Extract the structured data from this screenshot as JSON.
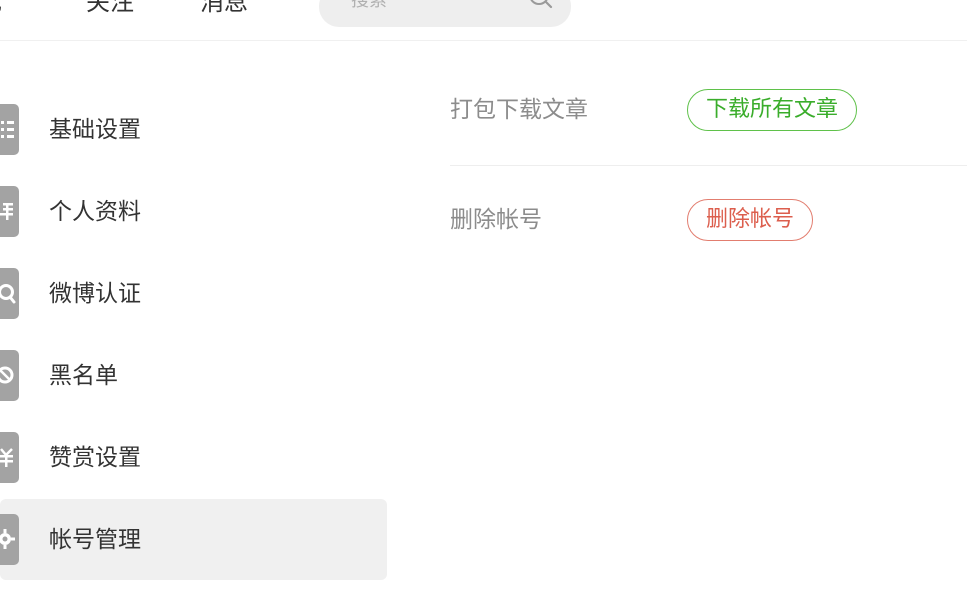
{
  "topnav": {
    "links": [
      "现",
      "关注",
      "消息"
    ],
    "search": {
      "placeholder": "搜索"
    }
  },
  "sidebar": {
    "items": [
      {
        "label": "基础设置",
        "icon": "list-icon",
        "active": false
      },
      {
        "label": "个人资料",
        "icon": "profile-icon",
        "active": false
      },
      {
        "label": "微博认证",
        "icon": "verify-icon",
        "active": false
      },
      {
        "label": "黑名单",
        "icon": "block-icon",
        "active": false
      },
      {
        "label": "赞赏设置",
        "icon": "reward-icon",
        "active": false
      },
      {
        "label": "帐号管理",
        "icon": "gear-icon",
        "active": true
      }
    ]
  },
  "main": {
    "download": {
      "label": "打包下载文章",
      "button": "下载所有文章",
      "color": "#3aad2b"
    },
    "delete": {
      "label": "删除帐号",
      "button": "删除帐号",
      "color": "#dc5e4d"
    }
  },
  "colors": {
    "active_bg": "#f0f0f0",
    "icon_bg": "#a3a3a3",
    "search_bg": "#eeeeee"
  }
}
